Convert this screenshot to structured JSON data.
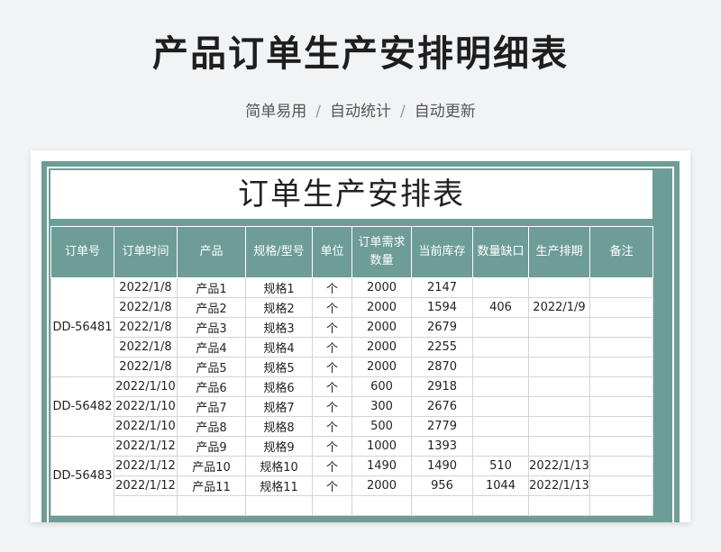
{
  "page": {
    "title": "产品订单生产安排明细表",
    "subtitle_items": [
      "简单易用",
      "自动统计",
      "自动更新"
    ],
    "subtitle_separator": "/"
  },
  "sheet": {
    "title": "订单生产安排表",
    "headers": [
      "订单号",
      "订单时间",
      "产品",
      "规格/型号",
      "单位",
      "订单需求数量",
      "当前库存",
      "数量缺口",
      "生产排期",
      "备注"
    ],
    "groups": [
      {
        "order_no": "DD-56481",
        "rows": [
          {
            "date": "2022/1/8",
            "product": "产品1",
            "spec": "规格1",
            "unit": "个",
            "demand": "2000",
            "stock": "2147",
            "gap": "",
            "schedule": "",
            "note": ""
          },
          {
            "date": "2022/1/8",
            "product": "产品2",
            "spec": "规格2",
            "unit": "个",
            "demand": "2000",
            "stock": "1594",
            "gap": "406",
            "schedule": "2022/1/9",
            "note": ""
          },
          {
            "date": "2022/1/8",
            "product": "产品3",
            "spec": "规格3",
            "unit": "个",
            "demand": "2000",
            "stock": "2679",
            "gap": "",
            "schedule": "",
            "note": ""
          },
          {
            "date": "2022/1/8",
            "product": "产品4",
            "spec": "规格4",
            "unit": "个",
            "demand": "2000",
            "stock": "2255",
            "gap": "",
            "schedule": "",
            "note": ""
          },
          {
            "date": "2022/1/8",
            "product": "产品5",
            "spec": "规格5",
            "unit": "个",
            "demand": "2000",
            "stock": "2870",
            "gap": "",
            "schedule": "",
            "note": ""
          }
        ]
      },
      {
        "order_no": "DD-56482",
        "rows": [
          {
            "date": "2022/1/10",
            "product": "产品6",
            "spec": "规格6",
            "unit": "个",
            "demand": "600",
            "stock": "2918",
            "gap": "",
            "schedule": "",
            "note": ""
          },
          {
            "date": "2022/1/10",
            "product": "产品7",
            "spec": "规格7",
            "unit": "个",
            "demand": "300",
            "stock": "2676",
            "gap": "",
            "schedule": "",
            "note": ""
          },
          {
            "date": "2022/1/10",
            "product": "产品8",
            "spec": "规格8",
            "unit": "个",
            "demand": "500",
            "stock": "2779",
            "gap": "",
            "schedule": "",
            "note": ""
          }
        ]
      },
      {
        "order_no": "DD-56483",
        "rows": [
          {
            "date": "2022/1/12",
            "product": "产品9",
            "spec": "规格9",
            "unit": "个",
            "demand": "1000",
            "stock": "1393",
            "gap": "",
            "schedule": "",
            "note": ""
          },
          {
            "date": "2022/1/12",
            "product": "产品10",
            "spec": "规格10",
            "unit": "个",
            "demand": "1490",
            "stock": "1490",
            "gap": "510",
            "schedule": "2022/1/13",
            "note": ""
          },
          {
            "date": "2022/1/12",
            "product": "产品11",
            "spec": "规格11",
            "unit": "个",
            "demand": "2000",
            "stock": "956",
            "gap": "1044",
            "schedule": "2022/1/13",
            "note": ""
          },
          {
            "date": "",
            "product": "",
            "spec": "",
            "unit": "",
            "demand": "",
            "stock": "",
            "gap": "",
            "schedule": "",
            "note": ""
          }
        ]
      }
    ]
  },
  "colors": {
    "header_bg": "#6d9d96",
    "page_bg": "#f2f3f5"
  }
}
